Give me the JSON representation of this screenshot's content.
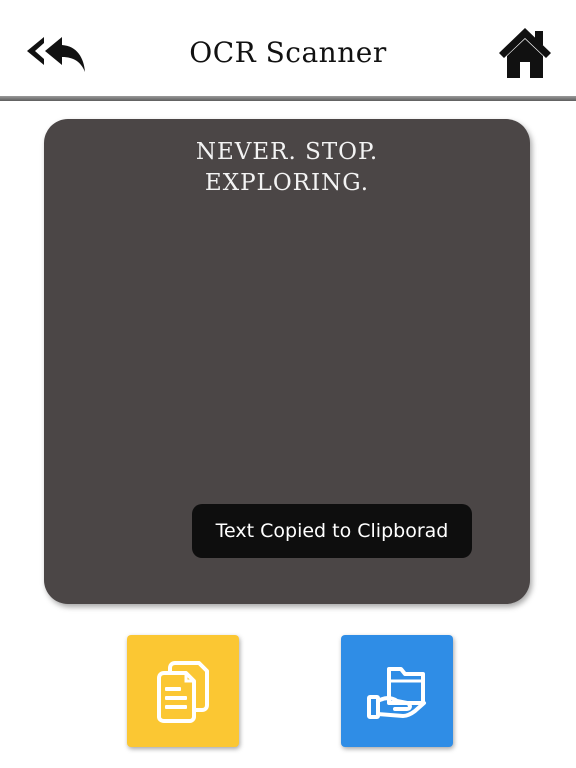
{
  "header": {
    "title": "OCR Scanner",
    "back_icon": "double-reply-arrow-icon",
    "home_icon": "home-icon"
  },
  "result": {
    "scanned_text": "NEVER. STOP.\nEXPLORING."
  },
  "toast": {
    "message": "Text Copied to Clipborad"
  },
  "actions": {
    "copy_icon": "copy-document-icon",
    "share_icon": "folder-in-hand-icon"
  },
  "colors": {
    "panel": "#4b4646",
    "copy_button": "#fbc733",
    "share_button": "#2f8de6",
    "toast": "#0e0e0e"
  }
}
